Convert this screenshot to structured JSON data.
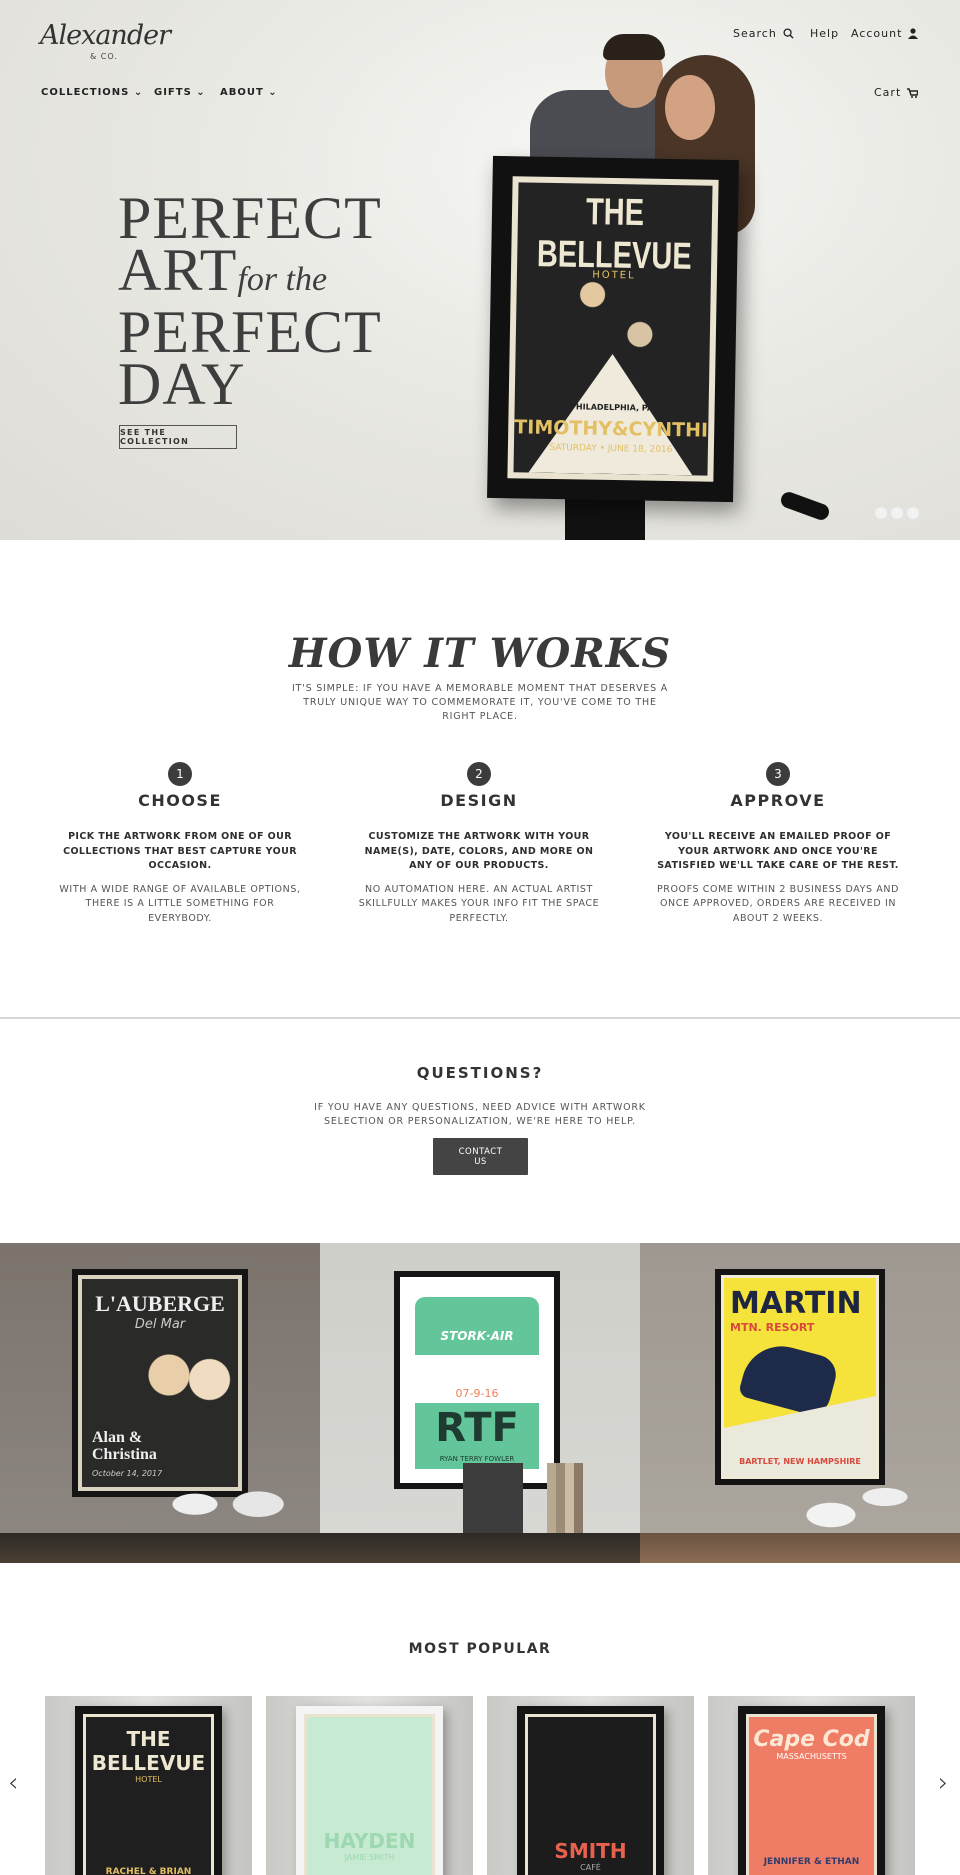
{
  "header": {
    "logo": "Alexander",
    "logo_sub": "& CO.",
    "search": "Search",
    "help": "Help",
    "account": "Account",
    "cart": "Cart",
    "nav": [
      {
        "label": "COLLECTIONS"
      },
      {
        "label": "GIFTS"
      },
      {
        "label": "ABOUT"
      }
    ]
  },
  "hero": {
    "line1": "PERFECT",
    "line2": "ART",
    "line2_italic": "for the",
    "line3": "PERFECT",
    "line4": "DAY",
    "button": "SEE THE COLLECTION",
    "poster": {
      "title": "THE BELLEVUE",
      "sub": "HOTEL",
      "city": "PHILADELPHIA, PA",
      "names": "TIMOTHY&CYNTHIA",
      "date": "SATURDAY • JUNE 18, 2016"
    },
    "slides": 3,
    "active_slide": 1
  },
  "how": {
    "title": "HOW IT WORKS",
    "subtitle": "IT'S SIMPLE: IF YOU HAVE A MEMORABLE MOMENT THAT DESERVES A TRULY UNIQUE WAY TO COMMEMORATE IT, YOU'VE COME TO THE RIGHT PLACE.",
    "steps": [
      {
        "num": "1",
        "title": "CHOOSE",
        "bold": "PICK THE ARTWORK FROM ONE OF OUR COLLECTIONS THAT BEST CAPTURE YOUR OCCASION.",
        "desc": "WITH A WIDE RANGE OF AVAILABLE OPTIONS, THERE IS A LITTLE SOMETHING FOR EVERYBODY."
      },
      {
        "num": "2",
        "title": "DESIGN",
        "bold": "CUSTOMIZE THE ARTWORK WITH YOUR NAME(S), DATE, COLORS, AND MORE ON ANY OF OUR PRODUCTS.",
        "desc": "NO AUTOMATION HERE. AN ACTUAL ARTIST SKILLFULLY MAKES YOUR INFO FIT THE SPACE PERFECTLY."
      },
      {
        "num": "3",
        "title": "APPROVE",
        "bold": "YOU'LL RECEIVE AN EMAILED PROOF OF YOUR ARTWORK AND ONCE YOU'RE SATISFIED WE'LL TAKE CARE OF THE REST.",
        "desc": "PROOFS COME WITHIN 2 BUSINESS DAYS AND ONCE APPROVED, ORDERS ARE RECEIVED IN ABOUT 2 WEEKS."
      }
    ]
  },
  "questions": {
    "title": "QUESTIONS?",
    "text": "IF YOU HAVE ANY QUESTIONS, NEED ADVICE WITH ARTWORK SELECTION OR PERSONALIZATION, WE'RE HERE TO HELP.",
    "button": "CONTACT US"
  },
  "gallery": [
    {
      "title": "L'AUBERGE",
      "sub": "Del Mar",
      "names": "Alan & Christina",
      "date": "October 14, 2017"
    },
    {
      "title": "STORK·AIR",
      "date": "07-9-16",
      "code": "RTF",
      "name": "RYAN TERRY FOWLER"
    },
    {
      "title": "MARTIN",
      "sub": "MTN. RESORT",
      "place": "BARTLET, NEW HAMPSHIRE"
    }
  ],
  "popular": {
    "title": "MOST POPULAR",
    "items": [
      {
        "title": "THE BELLEVUE",
        "sub": "HOTEL",
        "names": "RACHEL & BRIAN",
        "bg": "#1f1f1f",
        "fg": "#eee7d2",
        "accent": "#e3c064"
      },
      {
        "title": "HAYDEN",
        "sub": "JAMIE SMITH",
        "bg": "#cfe9d6",
        "fg": "#b8e3c6",
        "accent": "#9dd8b0"
      },
      {
        "title": "SMITH",
        "sub": "CAFÉ",
        "bg": "#1c1c1c",
        "fg": "#e8614f",
        "accent": "#aaa"
      },
      {
        "title": "Cape Cod",
        "sub": "MASSACHUSETTS",
        "names": "JENNIFER & ETHAN",
        "bg": "#ef7d66",
        "fg": "#fbe8d5",
        "accent": "#2f3c6e"
      }
    ]
  }
}
